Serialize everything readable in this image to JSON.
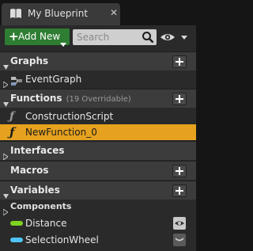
{
  "tab": {
    "title": "My Blueprint",
    "close": "✕"
  },
  "toolbar": {
    "add_label": "Add New",
    "search_placeholder": "Search"
  },
  "sections": {
    "graphs": {
      "label": "Graphs"
    },
    "functions": {
      "label": "Functions",
      "note": "(19 Overridable)"
    },
    "interfaces": {
      "label": "Interfaces"
    },
    "macros": {
      "label": "Macros"
    },
    "variables": {
      "label": "Variables"
    }
  },
  "items": {
    "event_graph": "EventGraph",
    "construction_script": "ConstructionScript",
    "new_function": "NewFunction_0",
    "components": "Components",
    "distance": "Distance",
    "selection_wheel": "SelectionWheel"
  },
  "colors": {
    "add_button": "#2e7d32",
    "selected_row": "#e6a21f",
    "float_variable": "#7ed321",
    "struct_variable": "#4fc3f7"
  },
  "icons": [
    "blueprint-icon",
    "close-icon",
    "plus-icon",
    "search-icon",
    "eye-icon",
    "graph-icon",
    "function-icon"
  ]
}
